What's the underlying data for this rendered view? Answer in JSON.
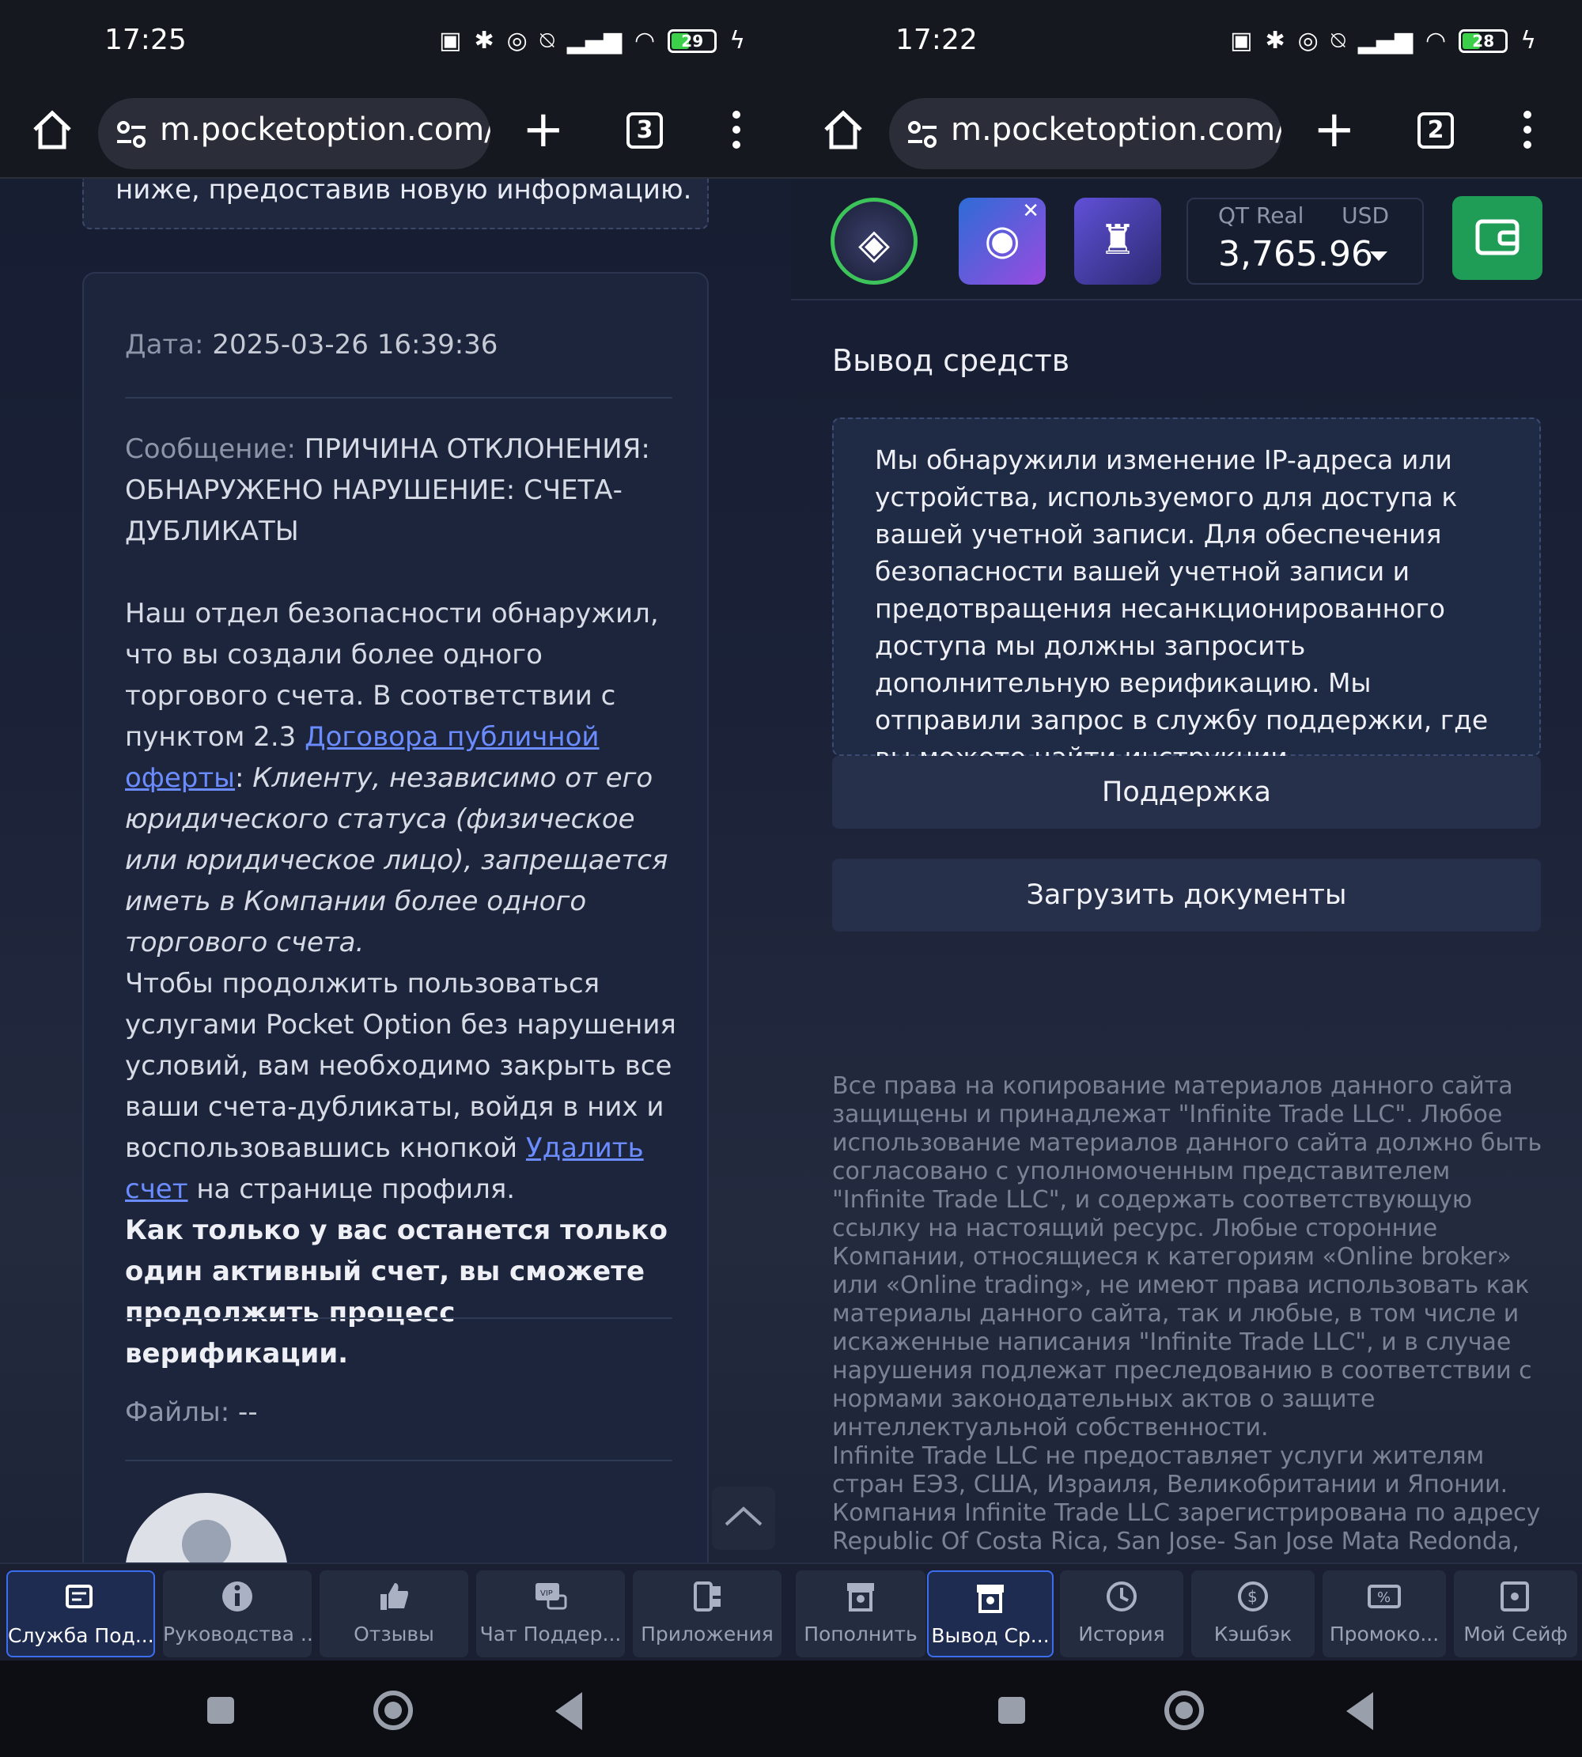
{
  "left": {
    "status": {
      "time": "17:25",
      "battery": "29"
    },
    "browser": {
      "url": "m.pocketoption.com/r",
      "tab_count": "3"
    },
    "top_notice": "ниже, предоставив новую информацию.",
    "ticket": {
      "date_label": "Дата:",
      "date_value": "2025-03-26 16:39:36",
      "message_label": "Сообщение:",
      "message_caps": "ПРИЧИНА ОТКЛОНЕНИЯ: ОБНАРУЖЕНО НАРУШЕНИЕ: СЧЕТА-ДУБЛИКАТЫ",
      "para1_a": "Наш отдел безопасности обнаружил, что вы создали более одного торгового счета. В соответствии с пунктом 2.3 ",
      "para1_link": "Договора публичной оферты",
      "para1_b": ": ",
      "para1_italic": "Клиенту, независимо от его юридического статуса (физическое или юридическое лицо), запрещается иметь в Компании более одного торгового счета.",
      "para2_a": "Чтобы продолжить пользоваться услугами Pocket Option без нарушения условий, вам необходимо закрыть все ваши счета-дубликаты, войдя в них и воспользовавшись кнопкой ",
      "para2_link": "Удалить счет",
      "para2_b": " на странице профиля.",
      "para3_bold": "Как только у вас останется только один активный счет, вы сможете продолжить процесс верификации.",
      "files_label": "Файлы:",
      "files_value": "--"
    }
  },
  "right": {
    "status": {
      "time": "17:22",
      "battery": "28"
    },
    "browser": {
      "url": "m.pocketoption.com/r",
      "tab_count": "2"
    },
    "account": {
      "type": "QT Real",
      "currency": "USD",
      "balance": "3,765.96"
    },
    "section_title": "Вывод средств",
    "notice": "Мы обнаружили изменение IP-адреса или устройства, используемого для доступа к вашей учетной записи. Для обеспечения безопасности вашей учетной записи и предотвращения несанкционированного доступа мы должны запросить дополнительную верификацию. Мы отправили запрос в службу поддержки, где вы можете найти инструкции.",
    "support_button": "Поддержка",
    "upload_button": "Загрузить документы",
    "footer": "Все права на копирование материалов данного сайта защищены и принадлежат \"Infinite Trade LLC\". Любое использование материалов данного сайта должно быть согласовано с уполномоченным представителем \"Infinite Trade LLC\", и содержать соответствующую ссылку на настоящий ресурс. Любые сторонние Компании, относящиеся к категориям «Online broker» или «Online trading», не имеют права использовать как материалы данного сайта, так и любые, в том числе и искаженные написания \"Infinite Trade LLC\", и в случае нарушения подлежат преследованию в соответствии с нормами законодательных актов о защите интеллектуальной собственности.",
    "footer2": "Infinite Trade LLC не предоставляет услуги жителям стран ЕЭЗ, США, Израиля, Великобритании и Японии.",
    "footer3": "Компания Infinite Trade LLC зарегистрирована по адресу Republic Of Costa Rica, San Jose- San Jose Mata Redonda,"
  },
  "bottom_nav": {
    "items": [
      {
        "label": "Служба Под...",
        "icon": "support-icon"
      },
      {
        "label": "Руководства ...",
        "icon": "info-icon"
      },
      {
        "label": "Отзывы",
        "icon": "thumbs-up-icon"
      },
      {
        "label": "Чат Поддер...",
        "icon": "vip-chat-icon"
      },
      {
        "label": "Приложения",
        "icon": "apps-icon"
      },
      {
        "label": "Пополнить",
        "icon": "deposit-icon"
      },
      {
        "label": "Вывод Ср...",
        "icon": "withdraw-icon"
      },
      {
        "label": "История",
        "icon": "history-icon"
      },
      {
        "label": "Кэшбэк",
        "icon": "cashback-icon"
      },
      {
        "label": "Промоко...",
        "icon": "promo-icon"
      },
      {
        "label": "Мой Сейф",
        "icon": "safe-icon"
      }
    ]
  },
  "colors": {
    "accent": "#3b6df0",
    "success": "#1f9d57",
    "link": "#6b8cff"
  }
}
